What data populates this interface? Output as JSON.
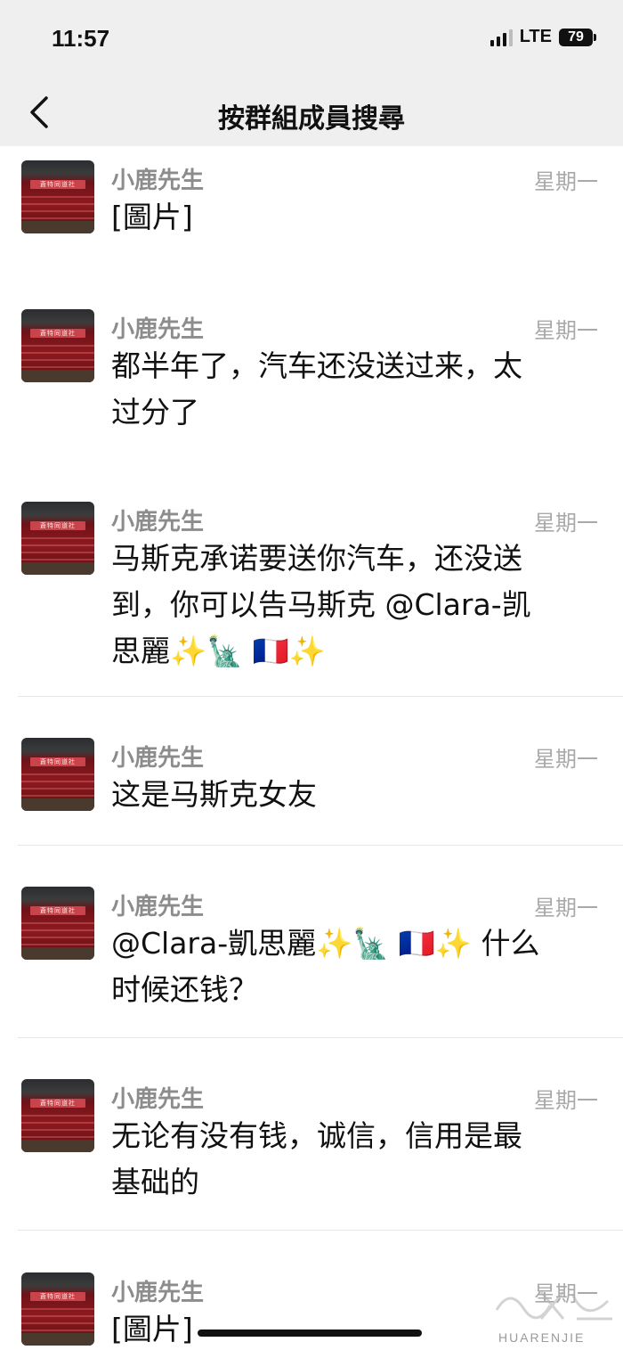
{
  "status_bar": {
    "time": "11:57",
    "network": "LTE",
    "battery": "79"
  },
  "nav": {
    "title": "按群組成員搜尋",
    "back_icon": "chevron-left-icon"
  },
  "avatar_sign_text": "蒼特同道社",
  "messages": [
    {
      "sender": "小鹿先生",
      "day": "星期一",
      "lines": [
        "[圖片]"
      ]
    },
    {
      "sender": "小鹿先生",
      "day": "星期一",
      "lines": [
        "都半年了，汽车还没送过来，太",
        "过分了"
      ]
    },
    {
      "sender": "小鹿先生",
      "day": "星期一",
      "lines": [
        "马斯克承诺要送你汽车，还没送",
        "到，你可以告马斯克 @Clara-凯",
        "思麗✨🗽 🇫🇷✨"
      ]
    },
    {
      "sender": "小鹿先生",
      "day": "星期一",
      "lines": [
        "这是马斯克女友"
      ]
    },
    {
      "sender": "小鹿先生",
      "day": "星期一",
      "lines": [
        "@Clara-凱思麗✨🗽 🇫🇷✨ 什么",
        "时候还钱？"
      ]
    },
    {
      "sender": "小鹿先生",
      "day": "星期一",
      "lines": [
        "无论有没有钱，诚信，信用是最",
        "基础的"
      ]
    },
    {
      "sender": "小鹿先生",
      "day": "星期一",
      "lines": [
        "[圖片]"
      ]
    }
  ],
  "watermark": {
    "text": "HUARENJIE"
  }
}
